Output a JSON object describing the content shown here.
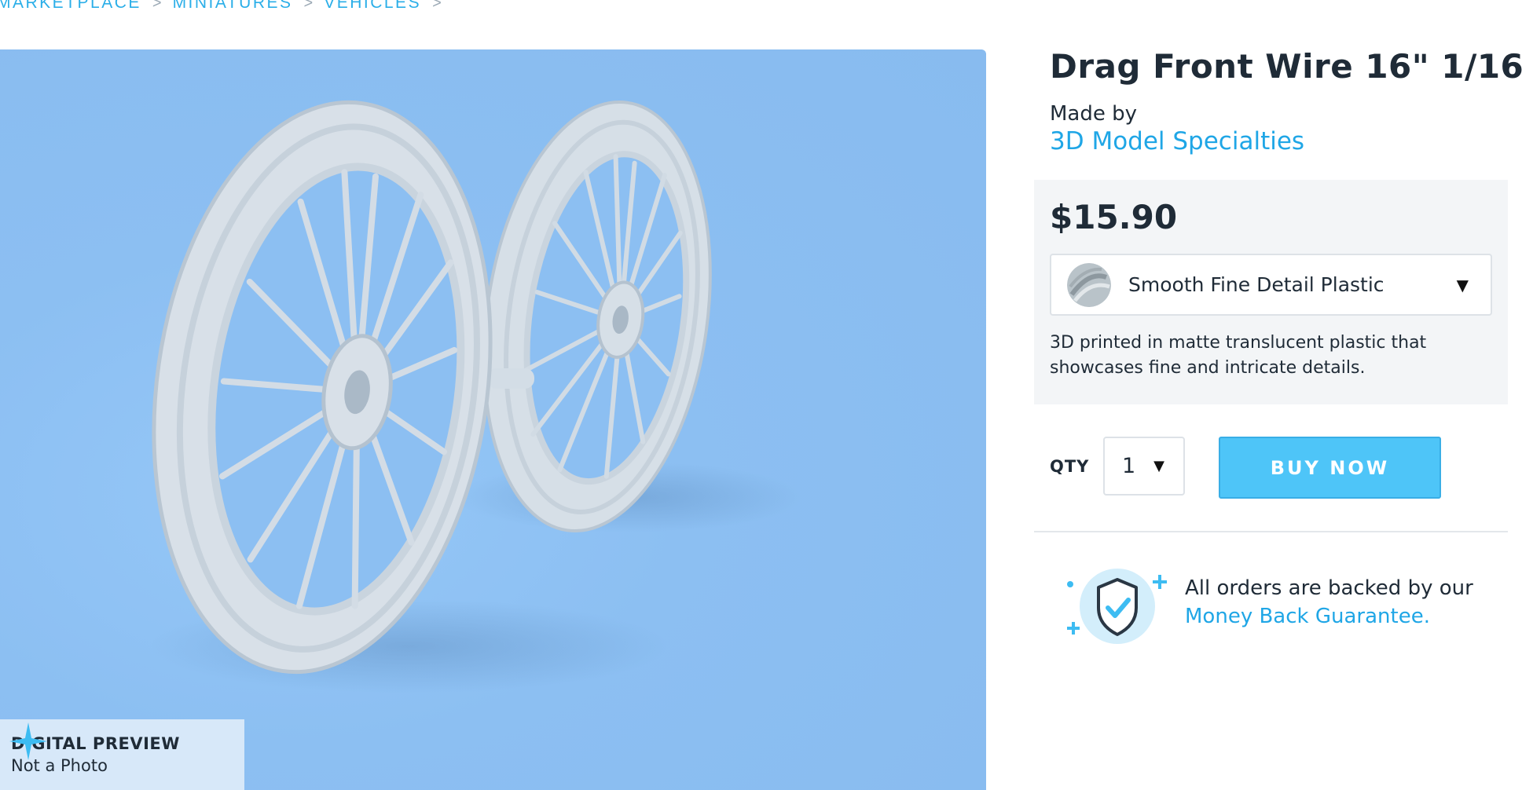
{
  "breadcrumb": {
    "items": [
      "MARKETPLACE",
      "MINIATURES",
      "VEHICLES"
    ],
    "separator": ">"
  },
  "preview": {
    "badge_title": "DIGITAL PREVIEW",
    "badge_subtitle": "Not a Photo",
    "background_color": "#8cbff2"
  },
  "product": {
    "title": "Drag Front Wire 16\" 1/16",
    "made_by_label": "Made by",
    "maker": "3D Model Specialties"
  },
  "pricing": {
    "price": "$15.90",
    "material": "Smooth Fine Detail Plastic",
    "material_description": "3D printed in matte translucent plastic that showcases fine and intricate details."
  },
  "purchase": {
    "qty_label": "QTY",
    "qty_value": "1",
    "buy_label": "BUY NOW",
    "accent_color": "#4ec5f8"
  },
  "guarantee": {
    "text": "All orders are backed by our",
    "link": "Money Back Guarantee."
  },
  "icons": [
    "chevron-right-icon",
    "sparkle-icon",
    "caret-down-icon",
    "shield-check-icon"
  ]
}
